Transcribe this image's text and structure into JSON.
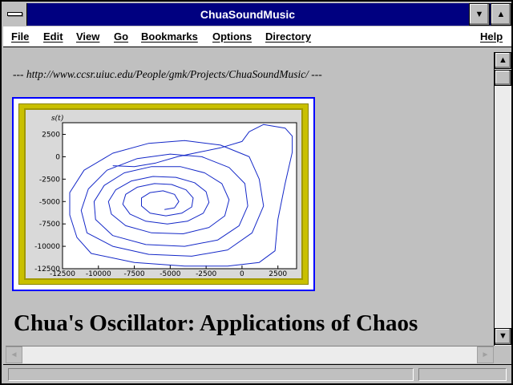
{
  "window": {
    "title": "ChuaSoundMusic"
  },
  "titlebar": {
    "minimize_glyph": "▼",
    "maximize_glyph": "▲"
  },
  "menu": {
    "items": [
      {
        "label": "File"
      },
      {
        "label": "Edit"
      },
      {
        "label": "View"
      },
      {
        "label": "Go"
      },
      {
        "label": "Bookmarks"
      },
      {
        "label": "Options"
      },
      {
        "label": "Directory"
      }
    ],
    "help": "Help"
  },
  "page": {
    "url_line": "--- http://www.ccsr.uiuc.edu/People/gmk/Projects/ChuaSoundMusic/ ---",
    "heading": "Chua's Oscillator: Applications of Chaos"
  },
  "scrollbar": {
    "up_glyph": "▲",
    "down_glyph": "▼",
    "left_glyph": "◄",
    "right_glyph": "►"
  },
  "statusbar": {
    "text": "",
    "progress": ""
  },
  "chart_data": {
    "type": "line",
    "ylabel": "s(t)",
    "x_ticks": [
      -12500,
      -10000,
      -7500,
      -5000,
      -2500,
      0,
      2500
    ],
    "y_ticks": [
      2500,
      0,
      -2500,
      -5000,
      -7500,
      -10000,
      -12500
    ],
    "xlim": [
      -12500,
      3800
    ],
    "ylim": [
      -12500,
      3800
    ],
    "series": [
      {
        "values_xy": [
          [
            -9000,
            -1000
          ],
          [
            -7500,
            -1100
          ],
          [
            -6000,
            -700
          ],
          [
            -4500,
            0
          ],
          [
            -3000,
            500
          ],
          [
            -1500,
            1000
          ],
          [
            0,
            1700
          ],
          [
            500,
            2800
          ],
          [
            1500,
            3600
          ],
          [
            3000,
            3200
          ],
          [
            3500,
            2300
          ],
          [
            3500,
            500
          ],
          [
            3000,
            -3000
          ],
          [
            2500,
            -7000
          ],
          [
            2300,
            -10500
          ],
          [
            1200,
            -11800
          ],
          [
            -1000,
            -12200
          ],
          [
            -4000,
            -12200
          ],
          [
            -7500,
            -11800
          ],
          [
            -10500,
            -10800
          ],
          [
            -11500,
            -9000
          ],
          [
            -12000,
            -6500
          ],
          [
            -12000,
            -4000
          ],
          [
            -11000,
            -1500
          ],
          [
            -9000,
            400
          ],
          [
            -6500,
            1500
          ],
          [
            -4000,
            1800
          ],
          [
            -1500,
            1300
          ],
          [
            500,
            0
          ],
          [
            1200,
            -2500
          ],
          [
            1500,
            -5500
          ],
          [
            700,
            -8500
          ],
          [
            -1000,
            -10400
          ],
          [
            -3500,
            -11100
          ],
          [
            -6500,
            -10900
          ],
          [
            -9000,
            -10000
          ],
          [
            -10800,
            -8500
          ],
          [
            -11200,
            -6000
          ],
          [
            -10700,
            -3600
          ],
          [
            -9400,
            -1500
          ],
          [
            -7300,
            -200
          ],
          [
            -5000,
            300
          ],
          [
            -2800,
            0
          ],
          [
            -900,
            -1200
          ],
          [
            200,
            -3000
          ],
          [
            400,
            -5500
          ],
          [
            -200,
            -7700
          ],
          [
            -1700,
            -9300
          ],
          [
            -4000,
            -10000
          ],
          [
            -6700,
            -9800
          ],
          [
            -9000,
            -8800
          ],
          [
            -10200,
            -7000
          ],
          [
            -10300,
            -5000
          ],
          [
            -9600,
            -3200
          ],
          [
            -8200,
            -1800
          ],
          [
            -6300,
            -1100
          ],
          [
            -4300,
            -1100
          ],
          [
            -2600,
            -1800
          ],
          [
            -1400,
            -3000
          ],
          [
            -900,
            -4800
          ],
          [
            -1200,
            -6600
          ],
          [
            -2300,
            -7900
          ],
          [
            -4100,
            -8600
          ],
          [
            -6300,
            -8500
          ],
          [
            -8100,
            -7700
          ],
          [
            -9100,
            -6400
          ],
          [
            -9300,
            -5000
          ],
          [
            -8800,
            -3700
          ],
          [
            -7700,
            -2700
          ],
          [
            -6200,
            -2200
          ],
          [
            -4600,
            -2300
          ],
          [
            -3300,
            -2900
          ],
          [
            -2500,
            -3900
          ],
          [
            -2300,
            -5100
          ],
          [
            -2700,
            -6300
          ],
          [
            -3800,
            -7200
          ],
          [
            -5200,
            -7500
          ],
          [
            -6700,
            -7200
          ],
          [
            -7800,
            -6400
          ],
          [
            -8300,
            -5300
          ],
          [
            -8100,
            -4200
          ],
          [
            -7300,
            -3400
          ],
          [
            -6100,
            -3000
          ],
          [
            -4900,
            -3100
          ],
          [
            -3900,
            -3700
          ],
          [
            -3400,
            -4600
          ],
          [
            -3500,
            -5600
          ],
          [
            -4200,
            -6300
          ],
          [
            -5300,
            -6600
          ],
          [
            -6400,
            -6300
          ],
          [
            -7000,
            -5500
          ],
          [
            -7000,
            -4600
          ],
          [
            -6400,
            -4000
          ],
          [
            -5500,
            -3800
          ],
          [
            -4700,
            -4200
          ],
          [
            -4400,
            -5000
          ],
          [
            -4700,
            -5700
          ],
          [
            -5400,
            -5900
          ]
        ]
      }
    ]
  }
}
